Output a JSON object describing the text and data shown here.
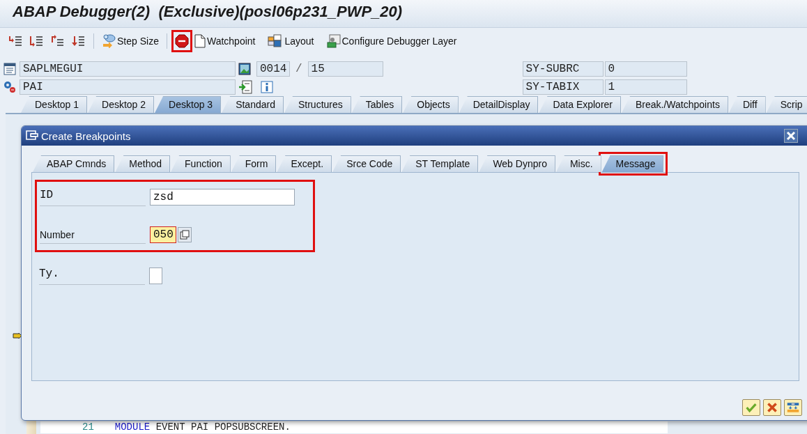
{
  "window": {
    "title": "ABAP Debugger(2)  (Exclusive)(posl06p231_PWP_20)"
  },
  "toolbar": {
    "step_size": "Step Size",
    "stop_highlighted": true,
    "buttons": [
      {
        "kind": "watchpoint",
        "label": "Watchpoint"
      },
      {
        "kind": "layout",
        "label": "Layout"
      },
      {
        "kind": "configure",
        "label": "Configure Debugger Layer"
      }
    ]
  },
  "header": {
    "program": "SAPLMEGUI",
    "event": "PAI",
    "line": "0014",
    "separator": "/",
    "total_lines": "15",
    "system_fields": [
      {
        "name": "SY-SUBRC",
        "value": "0"
      },
      {
        "name": "SY-TABIX",
        "value": "1"
      }
    ]
  },
  "desktop_tabs": [
    {
      "label": "Desktop 1",
      "selected": false
    },
    {
      "label": "Desktop 2",
      "selected": false
    },
    {
      "label": "Desktop 3",
      "selected": true
    },
    {
      "label": "Standard",
      "selected": false
    },
    {
      "label": "Structures",
      "selected": false
    },
    {
      "label": "Tables",
      "selected": false
    },
    {
      "label": "Objects",
      "selected": false
    },
    {
      "label": "DetailDisplay",
      "selected": false
    },
    {
      "label": "Data Explorer",
      "selected": false
    },
    {
      "label": "Break./Watchpoints",
      "selected": false
    },
    {
      "label": "Diff",
      "selected": false
    },
    {
      "label": "Scrip",
      "selected": false
    }
  ],
  "dialog": {
    "title": "Create Breakpoints",
    "tabs": [
      {
        "label": "ABAP Cmnds",
        "selected": false,
        "highlighted": false
      },
      {
        "label": "Method",
        "selected": false,
        "highlighted": false
      },
      {
        "label": "Function",
        "selected": false,
        "highlighted": false
      },
      {
        "label": "Form",
        "selected": false,
        "highlighted": false
      },
      {
        "label": "Except.",
        "selected": false,
        "highlighted": false
      },
      {
        "label": "Srce Code",
        "selected": false,
        "highlighted": false
      },
      {
        "label": "ST Template",
        "selected": false,
        "highlighted": false
      },
      {
        "label": "Web Dynpro",
        "selected": false,
        "highlighted": false
      },
      {
        "label": "Misc.",
        "selected": false,
        "highlighted": false
      },
      {
        "label": "Message",
        "selected": true,
        "highlighted": true
      }
    ],
    "fields_highlighted": true,
    "fields": [
      {
        "kind": "text",
        "label": "ID",
        "value": "zsd"
      },
      {
        "kind": "number",
        "label": "Number",
        "value": "050"
      },
      {
        "kind": "short",
        "label": "Ty."
      }
    ]
  },
  "code_line": {
    "number": "21",
    "keyword": "MODULE",
    "rest": "EVENT PAI POPSUBSCREEN."
  }
}
